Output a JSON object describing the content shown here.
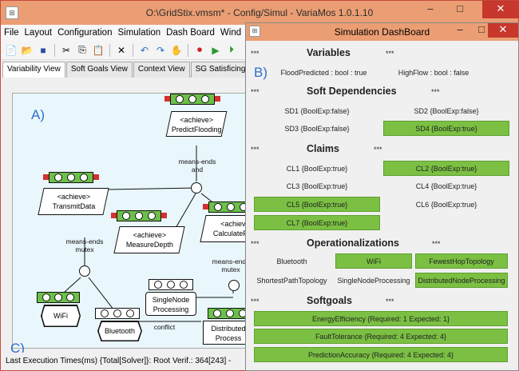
{
  "main_window": {
    "title": "O:\\GridStix.vmsm* - Config/Simul - VariaMos 1.0.1.10",
    "minimize": "–",
    "maximize": "□",
    "close": "✕",
    "menu": [
      "File",
      "Layout",
      "Configuration",
      "Simulation",
      "Dash Board",
      "Wind"
    ],
    "tabs": [
      "Variability View",
      "Soft Goals View",
      "Context View",
      "SG Satisficing"
    ],
    "status": "Last Execution Times(ms) {Total[Solver]}: Root Verif.: 364[243] -"
  },
  "labels": {
    "a": "A)",
    "b": "B)",
    "c": "C)"
  },
  "graph": {
    "predict_flooding": "<achieve>\nPredictFlooding",
    "transmit_data": "<achieve>\nTransmitData",
    "measure_depth": "<achieve>\nMeasureDepth",
    "calculate_flow": "<achiev\nCalculateFlo",
    "wifi": "WiFi",
    "bluetooth": "Bluetooth",
    "single_node": "SingleNode\nProcessing",
    "distributed": "Distributed\nProcess",
    "edge_means_ends_and": "means-ends\nand",
    "edge_means_ends_mutex1": "means-ends\nmutex",
    "edge_means_ends_mutex2": "means-ends\nmutex",
    "edge_conflict": "conflict"
  },
  "dashboard": {
    "title": "Simulation DashBoard",
    "minimize": "–",
    "maximize": "□",
    "close": "✕",
    "stars": "***",
    "variables": {
      "heading": "Variables",
      "items": [
        "FloodPredicted : bool : true",
        "HighFlow : bool : false"
      ]
    },
    "soft_dependencies": {
      "heading": "Soft Dependencies",
      "items": [
        "SD1 {BoolExp:false}",
        "SD2 {BoolExp:false}",
        "SD3 {BoolExp:false}",
        "SD4 {BoolExp:true}"
      ]
    },
    "claims": {
      "heading": "Claims",
      "items": [
        "CL1 {BoolExp:true}",
        "CL2 {BoolExp:true}",
        "CL3 {BoolExp:true}",
        "CL4 {BoolExp:true}",
        "CL5 {BoolExp:true}",
        "CL6 {BoolExp:true}",
        "CL7 {BoolExp:true}"
      ]
    },
    "operationalizations": {
      "heading": "Operationalizations",
      "items": [
        "Bluetooth",
        "WiFi",
        "FewestHopTopology",
        "ShortestPathTopology",
        "SingleNodeProcessing",
        "DistributedNodeProcessing"
      ]
    },
    "softgoals": {
      "heading": "Softgoals",
      "items": [
        "EnergyEfficiency {Required: 1 Expected: 1}",
        "FaultTolerance {Required: 4 Expected: 4}",
        "PredictionAccuracy {Required: 4 Expected: 4}"
      ]
    }
  },
  "colors": {
    "active_green": "#7bc043",
    "titlebar": "#eb9e73",
    "canvas_bg": "#e9f6fb",
    "label_blue": "#2b6fd0"
  }
}
